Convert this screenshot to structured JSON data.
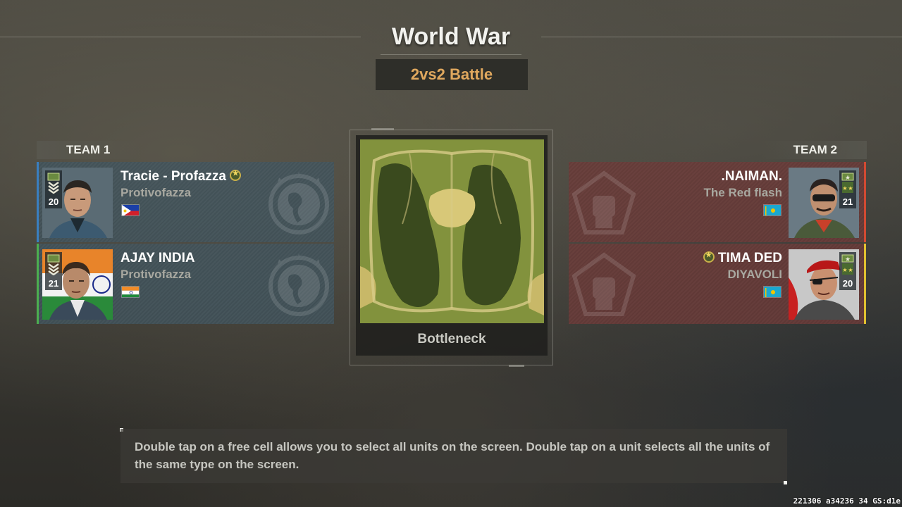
{
  "header": {
    "title": "World War",
    "mode": "2vs2 Battle"
  },
  "team1": {
    "label": "TEAM 1",
    "color": "#3a7fc0",
    "players": [
      {
        "name": "Tracie - Profazza",
        "clan": "Protivofazza",
        "rank": "20",
        "flag": "philippines-flag",
        "edge_color": "#3a7fc0"
      },
      {
        "name": "AJAY INDIA",
        "clan": "Protivofazza",
        "rank": "21",
        "flag": "india-flag",
        "edge_color": "#4caf50"
      }
    ]
  },
  "team2": {
    "label": "TEAM 2",
    "color": "#d24a32",
    "players": [
      {
        "name": ".NAIMAN.",
        "clan": "The Red flash",
        "rank": "21",
        "flag": "kazakhstan-flag",
        "edge_color": "#d24a32"
      },
      {
        "name": "TIMA DED",
        "clan": "DIYAVOLI",
        "rank": "20",
        "flag": "kazakhstan-flag",
        "edge_color": "#e0c030"
      }
    ]
  },
  "map": {
    "name": "Bottleneck"
  },
  "tip": {
    "text": "Double tap on a free cell allows you to select all units on the screen. Double tap on a unit selects all the units of the same type on the screen."
  },
  "build": {
    "text": "221306 a34236 34 GS:d1e"
  }
}
